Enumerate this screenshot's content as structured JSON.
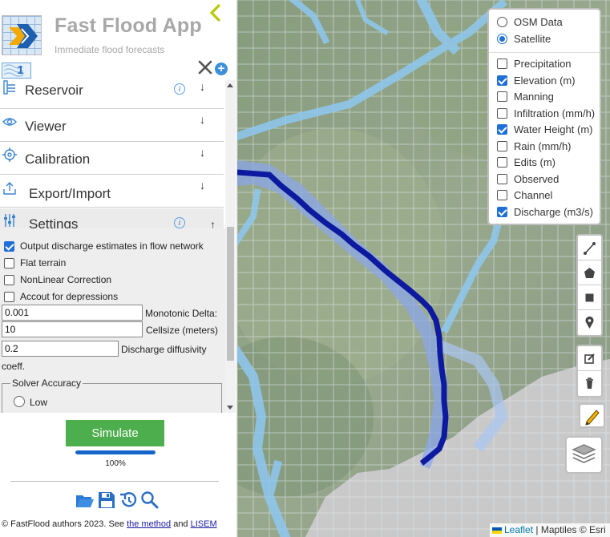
{
  "app": {
    "title": "Fast Flood App",
    "subtitle": "Immediate flood forecasts",
    "tab_badge": "1"
  },
  "sections": [
    {
      "label": "Reservoir",
      "icon": "reservoir-icon",
      "has_info": true,
      "expanded": false
    },
    {
      "label": "Viewer",
      "icon": "eye-icon",
      "has_info": false,
      "expanded": false
    },
    {
      "label": "Calibration",
      "icon": "target-icon",
      "has_info": false,
      "expanded": false
    },
    {
      "label": "Export/Import",
      "icon": "export-icon",
      "has_info": false,
      "expanded": false
    },
    {
      "label": "Settings",
      "icon": "sliders-icon",
      "has_info": true,
      "expanded": true
    }
  ],
  "info_glyph": "i",
  "arrow_down": "↓",
  "arrow_up": "↑",
  "settings": {
    "checkboxes": [
      {
        "label": "Output discharge estimates in flow network",
        "checked": true
      },
      {
        "label": "Flat terrain",
        "checked": false
      },
      {
        "label": "NonLinear Correction",
        "checked": false
      },
      {
        "label": "Accout for depressions",
        "checked": false
      }
    ],
    "monotonic_delta": {
      "value": "0.001",
      "label": "Monotonic Delta:"
    },
    "cellsize": {
      "value": "10",
      "label": "Cellsize (meters)"
    },
    "discharge_diffusivity": {
      "value": "0.2",
      "label": "Discharge diffusivity",
      "label_cont": "coeff."
    },
    "solver": {
      "legend": "Solver Accuracy",
      "options": [
        "Low"
      ]
    }
  },
  "simulate": {
    "label": "Simulate",
    "progress": 1.0,
    "progress_text": "100%"
  },
  "footer": {
    "prefix": "© FastFlood authors 2023. See ",
    "link1": "the method",
    "mid": " and ",
    "link2": "LISEM"
  },
  "layers": {
    "base": [
      {
        "label": "OSM Data",
        "selected": false
      },
      {
        "label": "Satellite",
        "selected": true
      }
    ],
    "overlays": [
      {
        "label": "Precipitation",
        "checked": false
      },
      {
        "label": "Elevation (m)",
        "checked": true
      },
      {
        "label": "Manning",
        "checked": false
      },
      {
        "label": "Infiltration (mm/h)",
        "checked": false
      },
      {
        "label": "Water Height (m)",
        "checked": true
      },
      {
        "label": "Rain (mm/h)",
        "checked": false
      },
      {
        "label": "Edits (m)",
        "checked": false
      },
      {
        "label": "Observed",
        "checked": false
      },
      {
        "label": "Channel",
        "checked": false
      },
      {
        "label": "Discharge (m3/s)",
        "checked": true
      }
    ]
  },
  "map_tools": [
    "polyline-icon",
    "polygon-icon",
    "rectangle-icon",
    "marker-icon",
    "edit-icon",
    "trash-icon"
  ],
  "attribution": {
    "leaflet": "Leaflet",
    "rest": " | Maptiles © Esri"
  },
  "colors": {
    "accent_green": "#4cae4c",
    "progress_blue": "#1565c8",
    "collapse_arrow": "#b7c900",
    "discharge_line": "#0d1aa0",
    "water_light": "#8ec8f0"
  }
}
